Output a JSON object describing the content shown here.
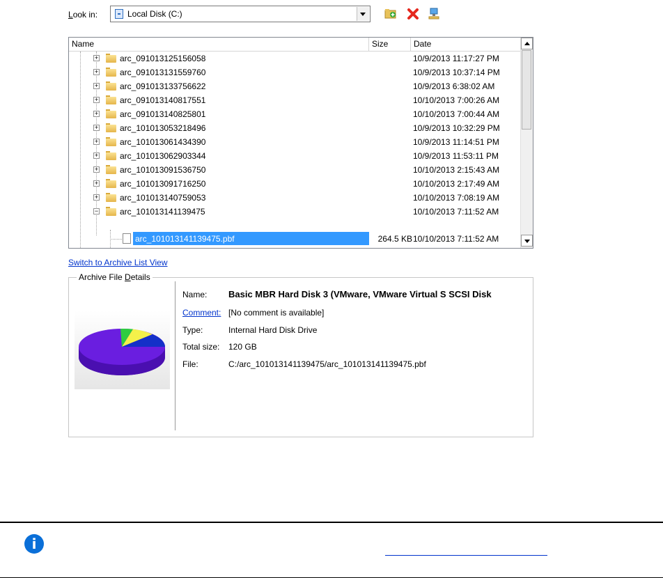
{
  "lookin": {
    "label_u": "L",
    "label_rest": "ook in:",
    "value": "Local Disk (C:)"
  },
  "toolbar_icons": [
    "new-folder-icon",
    "delete-icon",
    "network-icon"
  ],
  "list": {
    "columns": [
      "Name",
      "Size",
      "Date"
    ],
    "rows": [
      {
        "name": "arc_091013125156058",
        "size": "",
        "date": "10/9/2013 11:17:27 PM"
      },
      {
        "name": "arc_091013131559760",
        "size": "",
        "date": "10/9/2013 10:37:14 PM"
      },
      {
        "name": "arc_091013133756622",
        "size": "",
        "date": "10/9/2013 6:38:02 AM"
      },
      {
        "name": "arc_091013140817551",
        "size": "",
        "date": "10/10/2013 7:00:26 AM"
      },
      {
        "name": "arc_091013140825801",
        "size": "",
        "date": "10/10/2013 7:00:44 AM"
      },
      {
        "name": "arc_101013053218496",
        "size": "",
        "date": "10/9/2013 10:32:29 PM"
      },
      {
        "name": "arc_101013061434390",
        "size": "",
        "date": "10/9/2013 11:14:51 PM"
      },
      {
        "name": "arc_101013062903344",
        "size": "",
        "date": "10/9/2013 11:53:11 PM"
      },
      {
        "name": "arc_101013091536750",
        "size": "",
        "date": "10/10/2013 2:15:43 AM"
      },
      {
        "name": "arc_101013091716250",
        "size": "",
        "date": "10/10/2013 2:17:49 AM"
      },
      {
        "name": "arc_101013140759053",
        "size": "",
        "date": "10/10/2013 7:08:19 AM"
      },
      {
        "name": "arc_101013141139475",
        "size": "",
        "date": "10/10/2013 7:11:52 AM"
      }
    ],
    "selected": {
      "name": "arc_101013141139475.pbf",
      "size": "264.5 KB",
      "date": "10/10/2013 7:11:52 AM"
    }
  },
  "switch_link": "Switch to Archive List View",
  "details": {
    "legend_pre": "Archive File ",
    "legend_u": "D",
    "legend_post": "etails",
    "name_label": "Name:",
    "name_value": "Basic MBR Hard Disk 3 (VMware, VMware Virtual S SCSI Disk",
    "comment_label": "Comment:",
    "comment_value": "[No comment is available]",
    "type_label": "Type:",
    "type_value": "Internal Hard Disk Drive",
    "size_label": "Total size:",
    "size_value": "120 GB",
    "file_label": "File:",
    "file_value": "C:/arc_101013141139475/arc_101013141139475.pbf"
  },
  "colors": {
    "selection": "#3399ff",
    "link": "#0033cc",
    "info": "#0a6fd8",
    "pie_main": "#6a1ee0",
    "pie_green": "#2ecc40",
    "pie_yellow": "#f4f14a",
    "pie_blue": "#1430c8"
  }
}
